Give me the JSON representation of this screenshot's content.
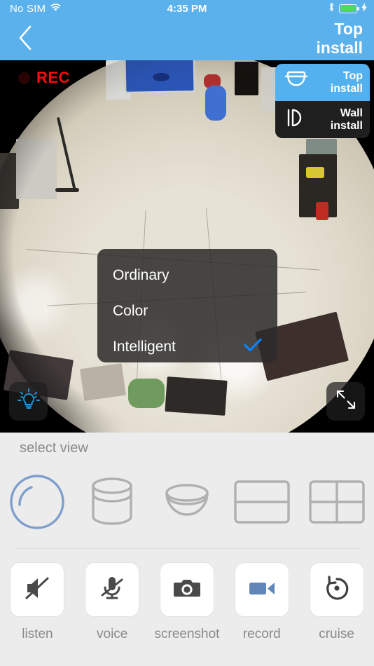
{
  "status_bar": {
    "carrier": "No SIM",
    "wifi_icon": "wifi-icon",
    "time": "4:35 PM",
    "bluetooth_icon": "bluetooth-icon",
    "battery_icon": "battery-icon",
    "charging_icon": "lightning-bolt-icon",
    "battery_color": "#4cd964"
  },
  "navbar": {
    "back_icon": "chevron-left-icon",
    "title": "Top\ninstall",
    "background_color": "#5bb1ec"
  },
  "video": {
    "recording_label": "REC",
    "recording_color": "#f60d0d",
    "light_button_icon": "light-bulb-icon",
    "light_button_color": "#2196d6",
    "fullscreen_button_icon": "expand-arrows-icon"
  },
  "install_menu": {
    "items": [
      {
        "label": "Top\ninstall",
        "icon": "dome-camera-icon",
        "selected": true
      },
      {
        "label": "Wall\ninstall",
        "icon": "wall-camera-icon",
        "selected": false
      }
    ],
    "active_color": "#53b1ef"
  },
  "options_modal": {
    "items": [
      {
        "label": "Ordinary",
        "checked": false
      },
      {
        "label": "Color",
        "checked": false
      },
      {
        "label": "Intelligent",
        "checked": true
      }
    ],
    "check_icon": "checkmark-icon",
    "check_color": "#0a84ff"
  },
  "select_view": {
    "label": "select view",
    "selected_color": "#7e9fcd",
    "items": [
      {
        "name": "sphere-view",
        "icon": "sphere-icon",
        "selected": true
      },
      {
        "name": "cylinder-view",
        "icon": "cylinder-icon",
        "selected": false
      },
      {
        "name": "bowl-view",
        "icon": "bowl-icon",
        "selected": false
      },
      {
        "name": "split-2-view",
        "icon": "two-pane-icon",
        "selected": false
      },
      {
        "name": "split-4-view",
        "icon": "four-pane-icon",
        "selected": false
      }
    ]
  },
  "controls": [
    {
      "label": "listen",
      "icon": "speaker-muted-icon",
      "active": false
    },
    {
      "label": "voice",
      "icon": "microphone-muted-icon",
      "active": false
    },
    {
      "label": "screenshot",
      "icon": "camera-icon",
      "active": false
    },
    {
      "label": "record",
      "icon": "camcorder-icon",
      "active": true
    },
    {
      "label": "cruise",
      "icon": "rotate-counterclockwise-icon",
      "active": false
    }
  ]
}
